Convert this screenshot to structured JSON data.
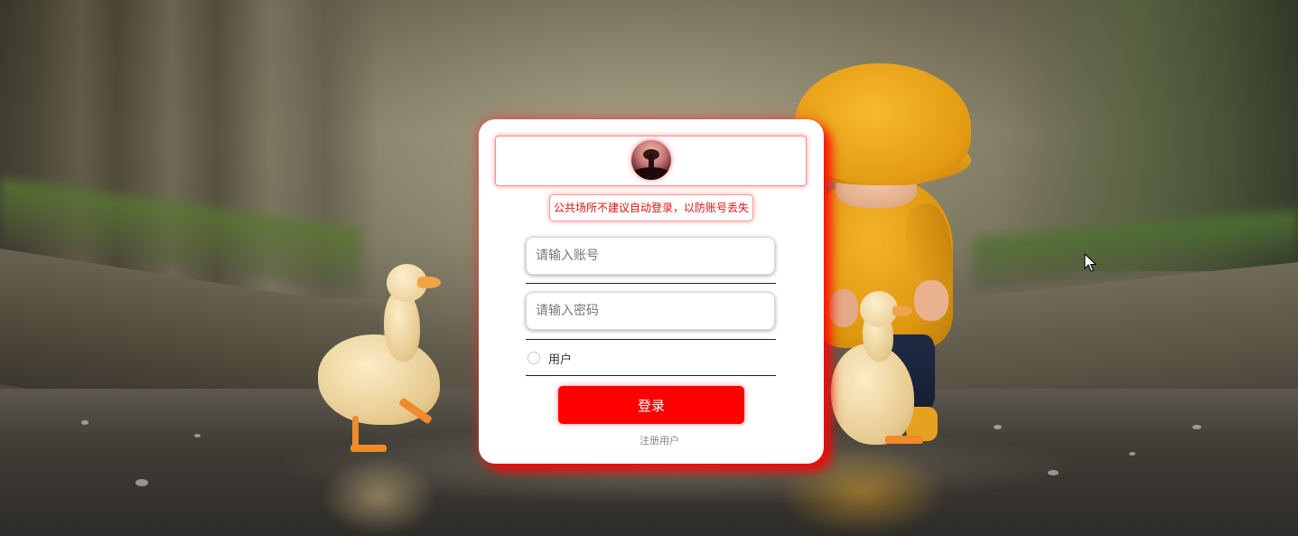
{
  "login": {
    "warning": "公共场所不建议自动登录，以防账号丢失",
    "account_placeholder": "请输入账号",
    "password_placeholder": "请输入密码",
    "role_label": "用户",
    "login_button": "登录",
    "register_link": "注册用户"
  },
  "colors": {
    "accent": "#ff0000",
    "warning_text": "#e01010"
  },
  "icons": {
    "avatar": "sunset-tree-avatar",
    "cursor": "mouse-pointer-icon"
  }
}
